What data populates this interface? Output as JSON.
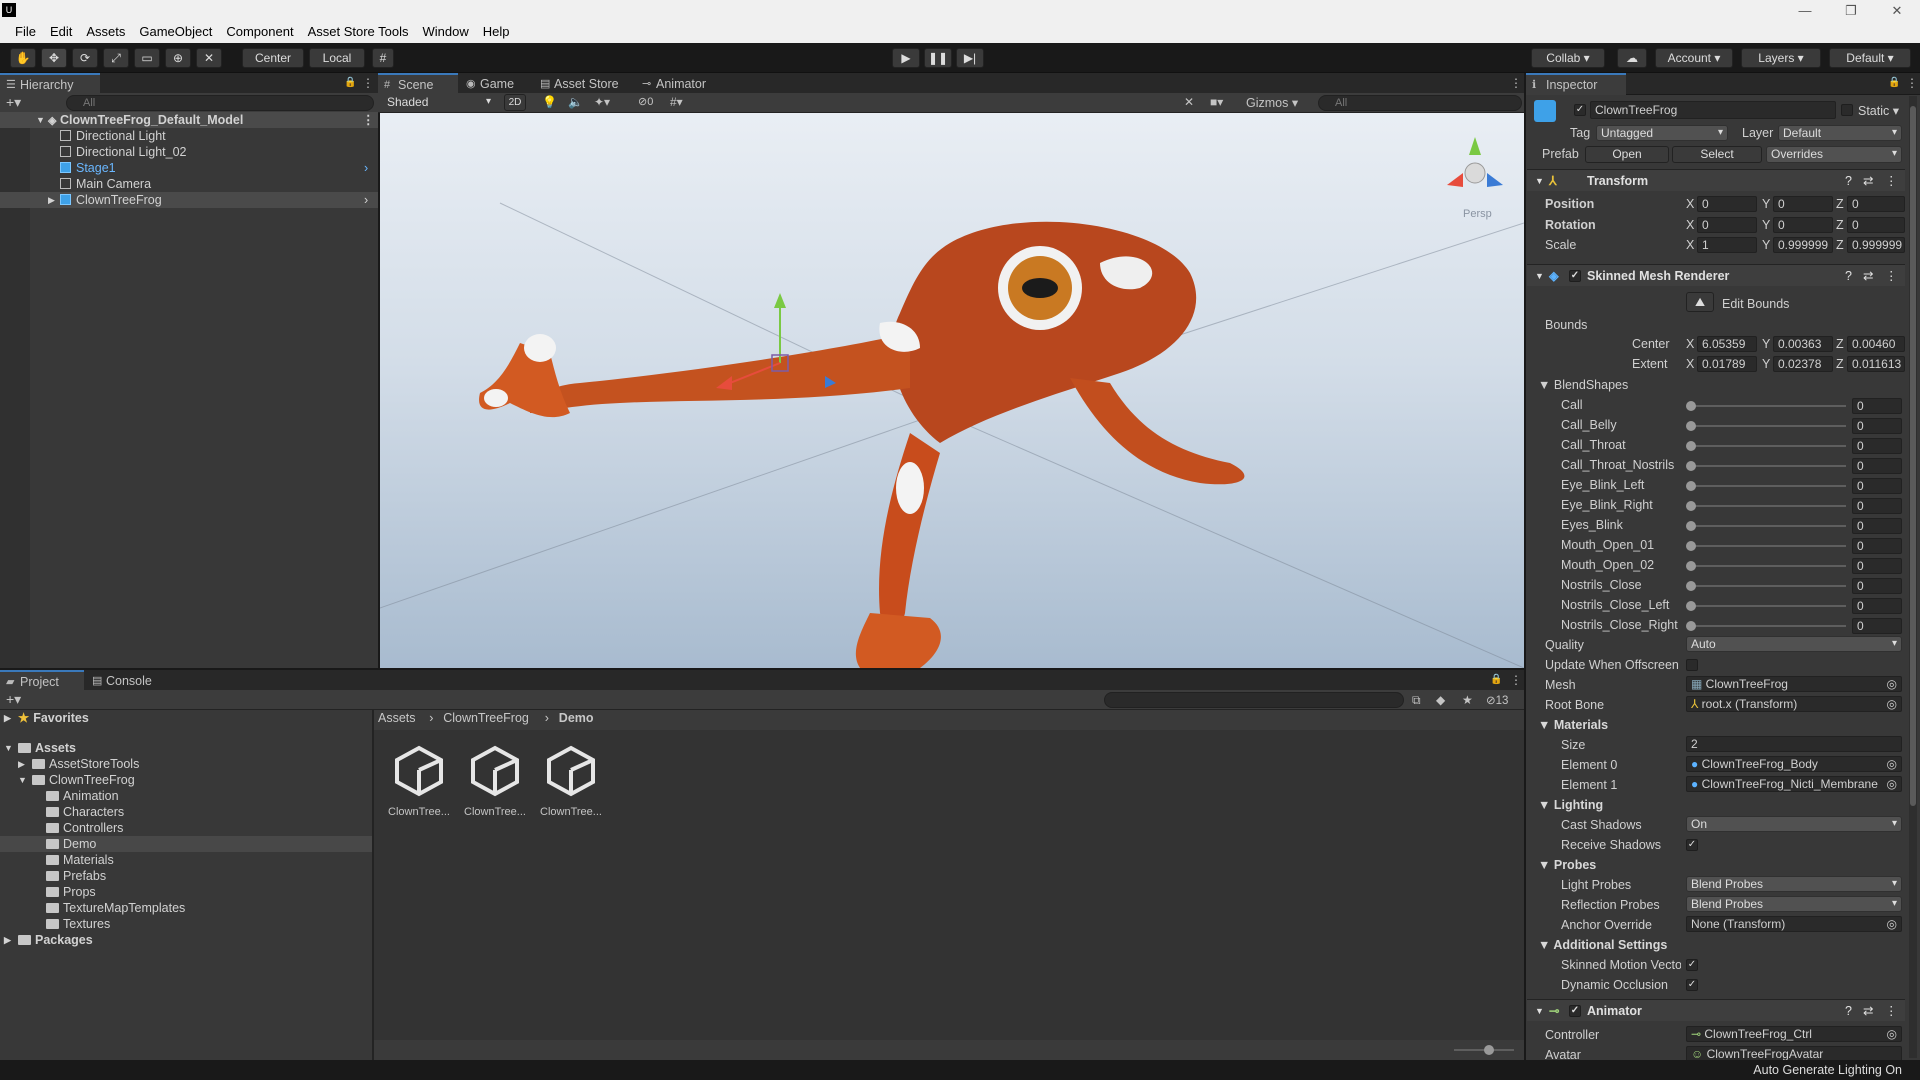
{
  "menubar": {
    "logo": "U",
    "items": [
      "File",
      "Edit",
      "Assets",
      "GameObject",
      "Component",
      "Asset Store Tools",
      "Window",
      "Help"
    ],
    "controls": [
      "—",
      "❐",
      "✕"
    ]
  },
  "toolbar": {
    "center": "Center",
    "local": "Local",
    "collab": "Collab",
    "account": "Account",
    "layers": "Layers",
    "layout": "Default"
  },
  "hierarchy": {
    "tab": "Hierarchy",
    "search_placeholder": "All",
    "root": "ClownTreeFrog_Default_Model",
    "items": [
      "Directional Light",
      "Directional Light_02",
      "Stage1",
      "Main Camera",
      "ClownTreeFrog"
    ]
  },
  "scene": {
    "tabs": [
      "Scene",
      "Game",
      "Asset Store",
      "Animator"
    ],
    "shading": "Shaded",
    "mode2d": "2D",
    "hidden_count": "0",
    "gizmos": "Gizmos",
    "search_placeholder": "All",
    "persp": "Persp"
  },
  "project": {
    "tabs": [
      "Project",
      "Console"
    ],
    "favorites": "Favorites",
    "assets": "Assets",
    "tree": [
      "AssetStoreTools",
      "ClownTreeFrog",
      "Animation",
      "Characters",
      "Controllers",
      "Demo",
      "Materials",
      "Prefabs",
      "Props",
      "TextureMapTemplates",
      "Textures"
    ],
    "packages": "Packages",
    "breadcrumb": [
      "Assets",
      "ClownTreeFrog",
      "Demo"
    ],
    "hidden_count": "13",
    "files": [
      "ClownTree...",
      "ClownTree...",
      "ClownTree..."
    ]
  },
  "inspector": {
    "tab": "Inspector",
    "object_name": "ClownTreeFrog",
    "static_label": "Static",
    "tag_label": "Tag",
    "tag_value": "Untagged",
    "layer_label": "Layer",
    "layer_value": "Default",
    "prefab_label": "Prefab",
    "prefab_open": "Open",
    "prefab_select": "Select",
    "prefab_overrides": "Overrides",
    "transform": {
      "title": "Transform",
      "position_label": "Position",
      "rotation_label": "Rotation",
      "scale_label": "Scale",
      "position": [
        "0",
        "0",
        "0"
      ],
      "rotation": [
        "0",
        "0",
        "0"
      ],
      "scale": [
        "1",
        "0.999999",
        "0.999999"
      ]
    },
    "smr": {
      "title": "Skinned Mesh Renderer",
      "edit_bounds": "Edit Bounds",
      "bounds": "Bounds",
      "center_label": "Center",
      "extent_label": "Extent",
      "center": [
        "6.05359",
        "0.00363",
        "0.00460"
      ],
      "extent": [
        "0.01789",
        "0.02378",
        "0.011613"
      ],
      "blendshapes_label": "BlendShapes",
      "blendshapes": [
        {
          "name": "Call",
          "value": "0"
        },
        {
          "name": "Call_Belly",
          "value": "0"
        },
        {
          "name": "Call_Throat",
          "value": "0"
        },
        {
          "name": "Call_Throat_Nostrils",
          "value": "0"
        },
        {
          "name": "Eye_Blink_Left",
          "value": "0"
        },
        {
          "name": "Eye_Blink_Right",
          "value": "0"
        },
        {
          "name": "Eyes_Blink",
          "value": "0"
        },
        {
          "name": "Mouth_Open_01",
          "value": "0"
        },
        {
          "name": "Mouth_Open_02",
          "value": "0"
        },
        {
          "name": "Nostrils_Close",
          "value": "0"
        },
        {
          "name": "Nostrils_Close_Left",
          "value": "0"
        },
        {
          "name": "Nostrils_Close_Right",
          "value": "0"
        }
      ],
      "quality_label": "Quality",
      "quality": "Auto",
      "update_offscreen_label": "Update When Offscreen",
      "mesh_label": "Mesh",
      "mesh": "ClownTreeFrog",
      "root_bone_label": "Root Bone",
      "root_bone": "root.x (Transform)",
      "materials_label": "Materials",
      "size_label": "Size",
      "size": "2",
      "element0_label": "Element 0",
      "element0": "ClownTreeFrog_Body",
      "element1_label": "Element 1",
      "element1": "ClownTreeFrog_Nicti_Membrane",
      "lighting_label": "Lighting",
      "cast_shadows_label": "Cast Shadows",
      "cast_shadows": "On",
      "receive_shadows_label": "Receive Shadows",
      "probes_label": "Probes",
      "light_probes_label": "Light Probes",
      "light_probes": "Blend Probes",
      "reflection_probes_label": "Reflection Probes",
      "reflection_probes": "Blend Probes",
      "anchor_label": "Anchor Override",
      "anchor": "None (Transform)",
      "additional_label": "Additional Settings",
      "skinned_motion_label": "Skinned Motion Vecto",
      "dynamic_occlusion_label": "Dynamic Occlusion"
    },
    "animator": {
      "title": "Animator",
      "controller_label": "Controller",
      "controller": "ClownTreeFrog_Ctrl",
      "avatar_label": "Avatar",
      "avatar": "ClownTreeFrogAvatar"
    }
  },
  "status": {
    "text": "Auto Generate Lighting On"
  },
  "colors": {
    "accent": "#3a79bb",
    "frog": "#b8471e",
    "sky_top": "#e8edf3",
    "sky_bottom": "#9eb2c8"
  }
}
